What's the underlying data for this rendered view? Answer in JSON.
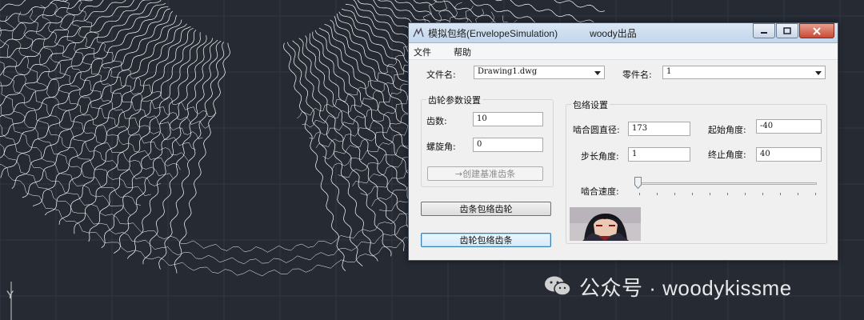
{
  "canvas": {
    "axis_label": "Y"
  },
  "watermark": {
    "text": "公众号 · woodykissme"
  },
  "window": {
    "title": "模拟包络(EnvelopeSimulation)            woody出品",
    "menu": [
      "文件",
      "帮助"
    ],
    "file_label": "文件名:",
    "file_value": "Drawing1.dwg",
    "part_label": "零件名:",
    "part_value": "1"
  },
  "gear_group": {
    "title": "齿轮参数设置",
    "teeth_label": "齿数:",
    "teeth_value": "10",
    "helix_label": "螺旋角:",
    "helix_value": "0",
    "create_button": "→创建基准齿条"
  },
  "buttons": {
    "rack_envelope_gear": "齿条包络齿轮",
    "gear_envelope_rack": "齿轮包络齿条"
  },
  "envelope_group": {
    "title": "包络设置",
    "diameter_label": "啮合圆直径:",
    "diameter_value": "173",
    "start_angle_label": "起始角度:",
    "start_angle_value": "-40",
    "step_label": "步长角度:",
    "step_value": "1",
    "end_angle_label": "终止角度:",
    "end_angle_value": "40",
    "speed_label": "啮合速度:",
    "speed_value": 0
  },
  "colors": {
    "title_bar": "#c3d6ec",
    "close_button": "#c84a33",
    "cad_background": "#252a33",
    "curve": "#ffffff"
  },
  "icons": [
    "app-icon",
    "minimize-icon",
    "maximize-icon",
    "close-icon",
    "wechat-icon",
    "dropdown-arrow-icon"
  ]
}
